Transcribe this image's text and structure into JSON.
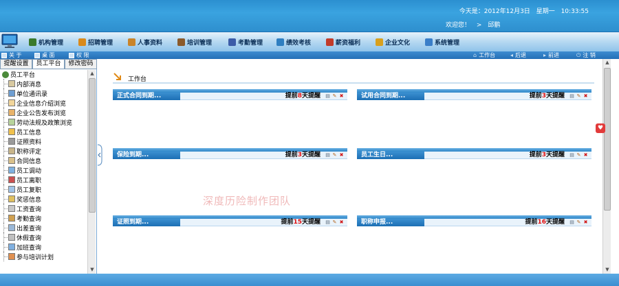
{
  "header": {
    "date_label": "今天是：2012年12月3日",
    "weekday": "星期一",
    "time": "10:33:55",
    "welcome_label": "欢迎您！",
    "separator": ">",
    "user": "邱鹏"
  },
  "menu": [
    {
      "label": "机构管理",
      "icon": "org-icon",
      "color": "#3a7a2c"
    },
    {
      "label": "招聘管理",
      "icon": "recruit-icon",
      "color": "#d98a1c"
    },
    {
      "label": "人事资料",
      "icon": "personnel-icon",
      "color": "#c9842a"
    },
    {
      "label": "培训管理",
      "icon": "training-icon",
      "color": "#8b5a2b"
    },
    {
      "label": "考勤管理",
      "icon": "attendance-icon",
      "color": "#3c5ca8"
    },
    {
      "label": "绩效考核",
      "icon": "performance-icon",
      "color": "#2f7fc1"
    },
    {
      "label": "薪资福利",
      "icon": "salary-icon",
      "color": "#c23b2a"
    },
    {
      "label": "企业文化",
      "icon": "culture-icon",
      "color": "#d8a01e"
    },
    {
      "label": "系统管理",
      "icon": "system-icon",
      "color": "#3a7ec8"
    }
  ],
  "subbar": {
    "left": [
      "关 于",
      "桌 面",
      "权 限"
    ],
    "right": [
      "工作台",
      "后退",
      "前进",
      "注 销"
    ]
  },
  "sidebar": {
    "tabs": [
      "提醒设置",
      "员工平台",
      "修改密码"
    ],
    "active_tab": 1,
    "root": "员工平台",
    "items": [
      "内部消息",
      "单位通讯录",
      "企业信息介绍浏览",
      "企业公告发布浏览",
      "劳动法规及政策浏览",
      "员工信息",
      "证照资料",
      "职称评定",
      "合同信息",
      "员工调动",
      "员工离职",
      "员工复职",
      "奖惩信息",
      "工资查询",
      "考勤查询",
      "出差查询",
      "休假查询",
      "加班查询",
      "参与培训计划"
    ]
  },
  "main": {
    "title": "工作台",
    "watermark": "深度历险制作团队",
    "panels": [
      {
        "title": "正式合同到期...",
        "pre": "提前",
        "num": "8",
        "post": "天提醒"
      },
      {
        "title": "试用合同到期...",
        "pre": "提前",
        "num": "3",
        "post": "天提醒"
      },
      {
        "title": "保险到期...",
        "pre": "提前",
        "num": "3",
        "post": "天提醒"
      },
      {
        "title": "员工生日...",
        "pre": "提前",
        "num": "3",
        "post": "天提醒"
      },
      {
        "title": "证照到期...",
        "pre": "提前",
        "num": "15",
        "post": "天提醒"
      },
      {
        "title": "职称申报...",
        "pre": "提前",
        "num": "16",
        "post": "天提醒"
      }
    ]
  },
  "colors": {
    "header_blue": "#2e8fce",
    "panel_title_blue": "#1c6fb4",
    "highlight_red": "#e01010"
  }
}
